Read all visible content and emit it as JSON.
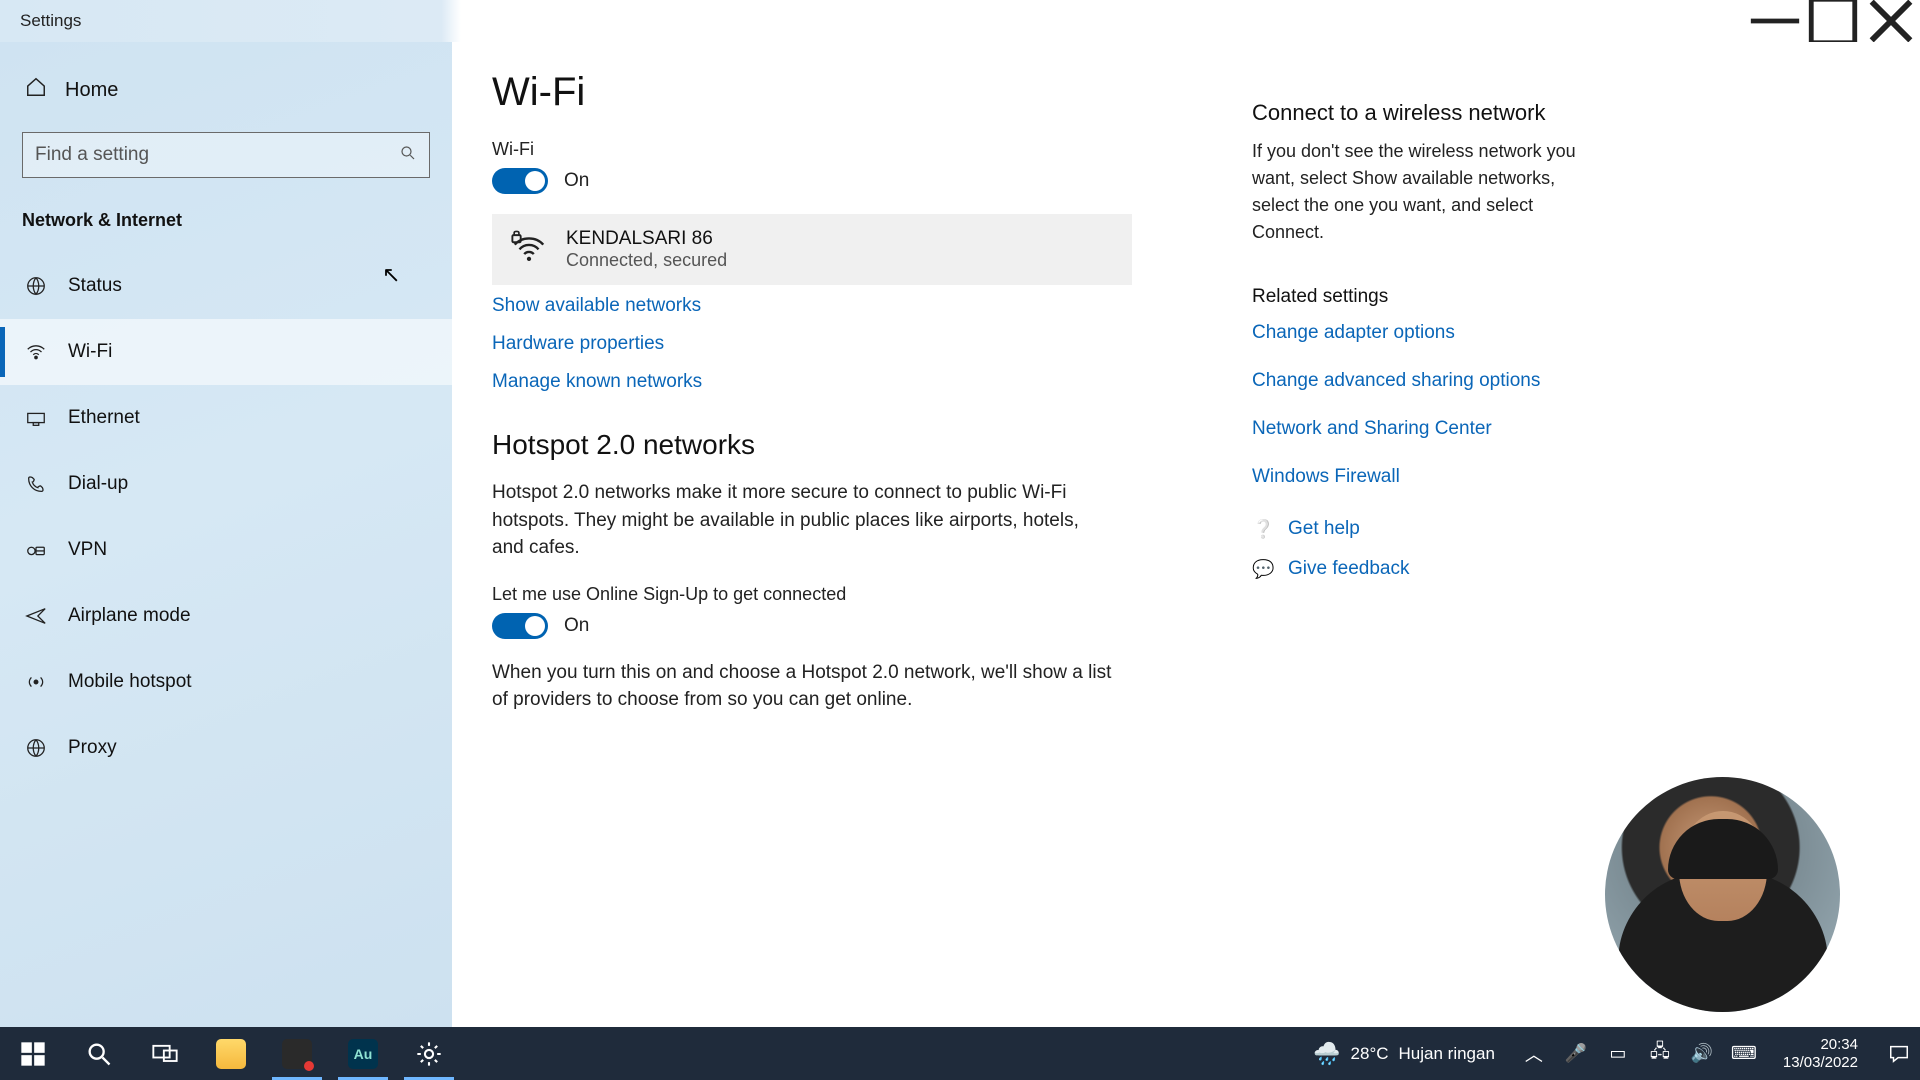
{
  "window": {
    "title": "Settings"
  },
  "sidebar": {
    "home": "Home",
    "search_placeholder": "Find a setting",
    "section": "Network & Internet",
    "items": [
      {
        "label": "Status"
      },
      {
        "label": "Wi-Fi"
      },
      {
        "label": "Ethernet"
      },
      {
        "label": "Dial-up"
      },
      {
        "label": "VPN"
      },
      {
        "label": "Airplane mode"
      },
      {
        "label": "Mobile hotspot"
      },
      {
        "label": "Proxy"
      }
    ]
  },
  "main": {
    "title": "Wi-Fi",
    "wifi_label": "Wi-Fi",
    "wifi_state": "On",
    "network": {
      "name": "KENDALSARI 86",
      "status": "Connected, secured"
    },
    "links": {
      "show_available": "Show available networks",
      "hardware": "Hardware properties",
      "manage_known": "Manage known networks"
    },
    "hotspot": {
      "title": "Hotspot 2.0 networks",
      "desc": "Hotspot 2.0 networks make it more secure to connect to public Wi-Fi hotspots. They might be available in public places like airports, hotels, and cafes.",
      "signup_label": "Let me use Online Sign-Up to get connected",
      "signup_state": "On",
      "signup_desc": "When you turn this on and choose a Hotspot 2.0 network, we'll show a list of providers to choose from so you can get online."
    }
  },
  "right": {
    "connect_title": "Connect to a wireless network",
    "connect_text": "If you don't see the wireless network you want, select Show available networks, select the one you want, and select Connect.",
    "related_title": "Related settings",
    "links": {
      "adapter": "Change adapter options",
      "sharing": "Change advanced sharing options",
      "center": "Network and Sharing Center",
      "firewall": "Windows Firewall"
    },
    "help": "Get help",
    "feedback": "Give feedback"
  },
  "taskbar": {
    "weather": {
      "temp": "28°C",
      "cond": "Hujan ringan"
    },
    "clock": {
      "time": "20:34",
      "date": "13/03/2022"
    }
  }
}
